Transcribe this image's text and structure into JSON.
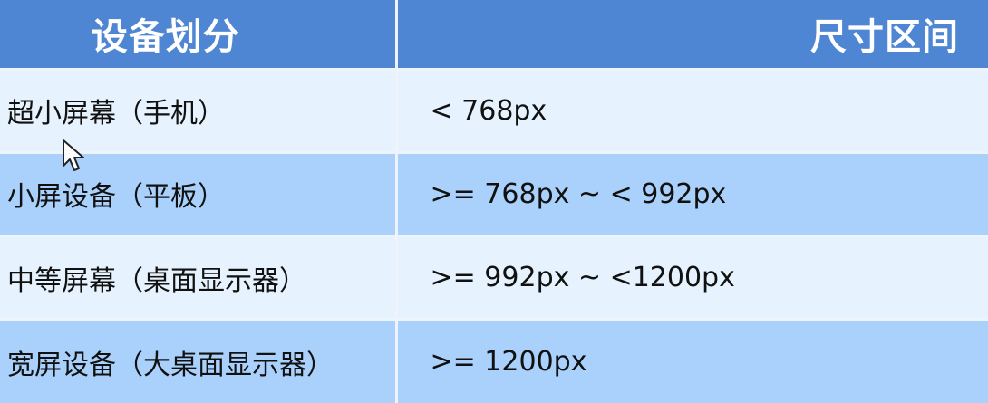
{
  "header": {
    "device_label": "设备划分",
    "size_label": "尺寸区间"
  },
  "rows": [
    {
      "device": "超小屏幕（手机）",
      "size": "< 768px"
    },
    {
      "device": "小屏设备（平板）",
      "size": ">= 768px  ~  < 992px"
    },
    {
      "device": "中等屏幕（桌面显示器）",
      "size": ">= 992px  ~  <1200px"
    },
    {
      "device": "宽屏设备（大桌面显示器）",
      "size": ">= 1200px"
    }
  ],
  "colors": {
    "header_bg": "#4f86d3",
    "row_light": "#e6f2fd",
    "row_dark": "#a9d1fb",
    "divider": "#eef4fb"
  },
  "icons": [
    "mouse-pointer-icon"
  ]
}
